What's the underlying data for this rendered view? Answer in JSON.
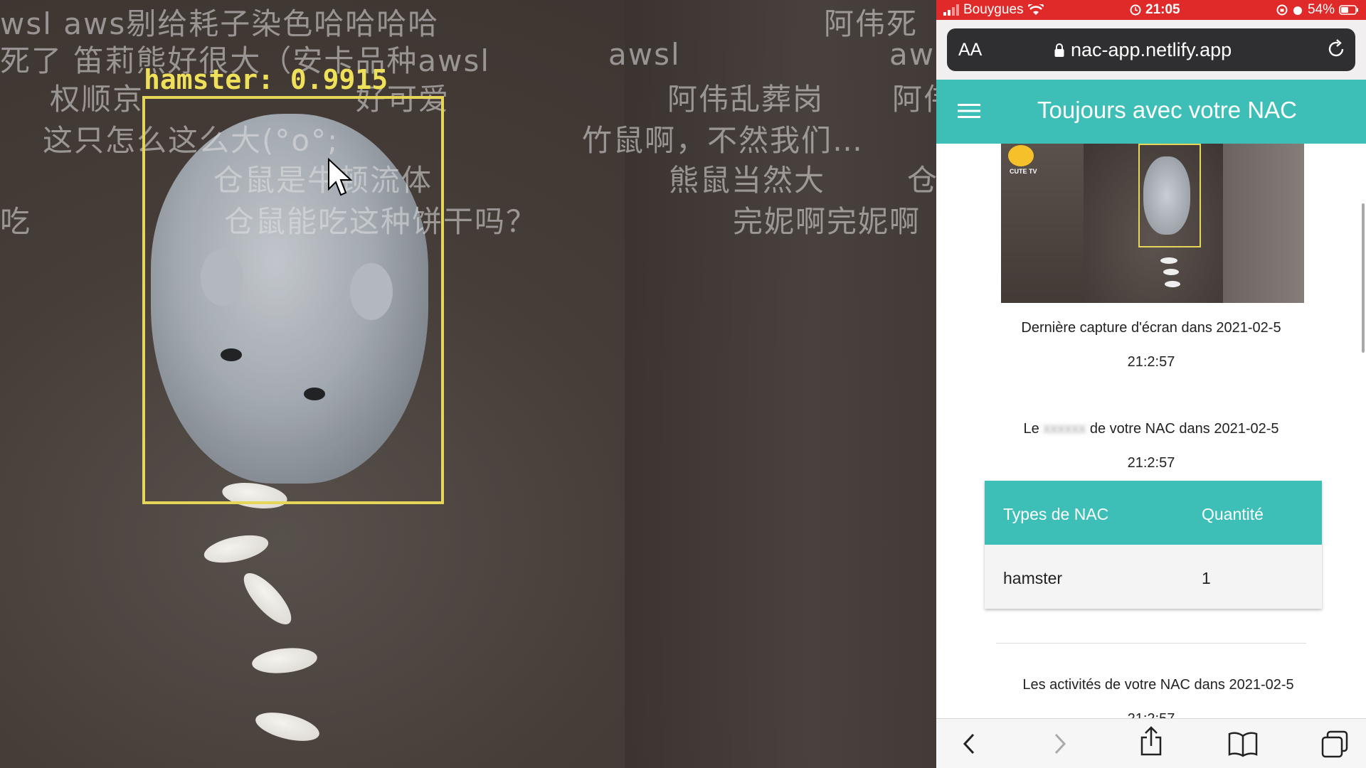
{
  "video": {
    "detection_label": "hamster: 0.9915",
    "danmaku": [
      "wsl aws剔给耗子染色哈哈哈哈",
      "死了 笛莉熊好很大（安卡品种awsl",
      "权顺京",
      "好可爱",
      "这只怎么这么大(°o°;",
      "仓鼠是牛顿流体",
      "吃",
      "仓鼠能吃这种饼干吗？",
      "awsl",
      "aws",
      "阿伟死",
      "阿伟乱葬岗",
      "阿伟",
      "竹鼠啊，不然我们…",
      "熊鼠当然大",
      "仓",
      "完妮啊完妮啊"
    ]
  },
  "status_bar": {
    "carrier": "Bouygues",
    "time": "21:05",
    "battery": "54%"
  },
  "browser": {
    "text_size_button": "AA",
    "url": "nac-app.netlify.app"
  },
  "app": {
    "title": "Toujours avec votre NAC",
    "thumbnail_badge": "CUTE TV",
    "screenshot_caption": "Dernière capture d'écran dans 2021-02-5",
    "screenshot_time": "21:2:57",
    "state_prefix": "Le",
    "state_blurred": "xxxxxx",
    "state_suffix": "de votre NAC dans 2021-02-5",
    "state_time": "21:2:57",
    "table": {
      "headers": [
        "Types de NAC",
        "Quantité"
      ],
      "rows": [
        [
          "hamster",
          "1"
        ]
      ]
    },
    "activities_caption": "Les activités de votre NAC dans 2021-02-5",
    "activities_time": "21:2:57"
  },
  "colors": {
    "accent": "#3dbfb7",
    "status_bar": "#e02a2a",
    "detection_box": "#e5d659"
  },
  "icons": [
    "signal-icon",
    "wifi-icon",
    "alarm-icon",
    "lock-icon",
    "reload-icon",
    "menu-icon",
    "back-icon",
    "forward-icon",
    "share-icon",
    "bookmarks-icon",
    "tabs-icon",
    "cursor-icon"
  ]
}
